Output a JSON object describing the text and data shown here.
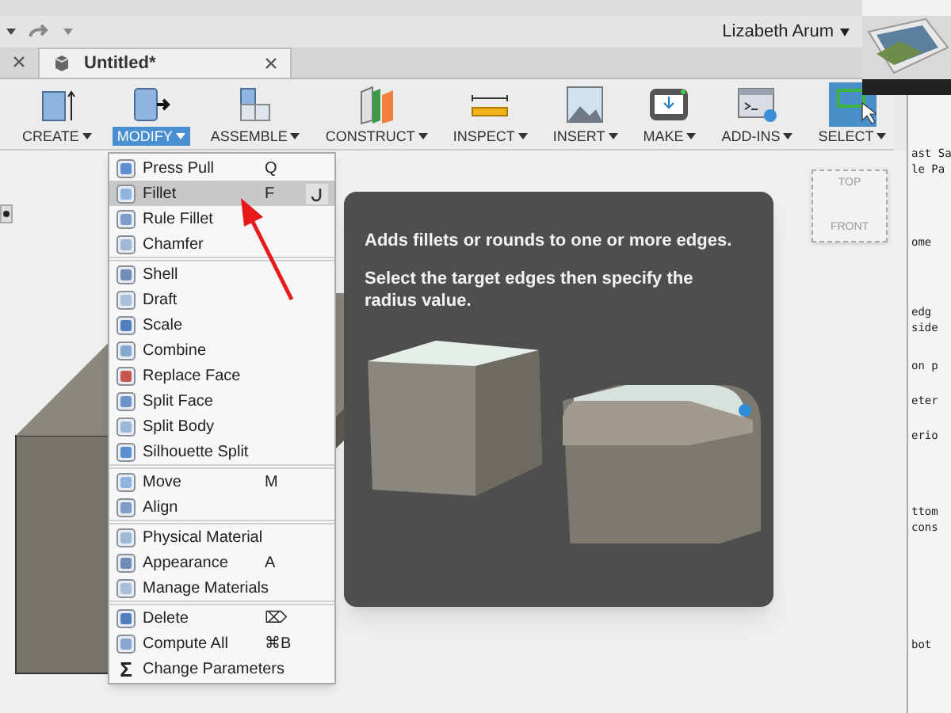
{
  "toolbar": {
    "user": "Lizabeth Arum"
  },
  "tabs": [
    {
      "label": "Untitled*",
      "selected": true
    }
  ],
  "ribbon": [
    {
      "label": "CREATE",
      "selected": false
    },
    {
      "label": "MODIFY",
      "selected": true
    },
    {
      "label": "ASSEMBLE",
      "selected": false
    },
    {
      "label": "CONSTRUCT",
      "selected": false
    },
    {
      "label": "INSPECT",
      "selected": false
    },
    {
      "label": "INSERT",
      "selected": false
    },
    {
      "label": "MAKE",
      "selected": false
    },
    {
      "label": "ADD-INS",
      "selected": false
    },
    {
      "label": "SELECT",
      "selected": false
    }
  ],
  "menu": {
    "sections": [
      [
        {
          "label": "Press Pull",
          "shortcut": "Q",
          "selected": false
        },
        {
          "label": "Fillet",
          "shortcut": "F",
          "selected": true
        },
        {
          "label": "Rule Fillet",
          "selected": false
        },
        {
          "label": "Chamfer",
          "selected": false
        }
      ],
      [
        {
          "label": "Shell",
          "selected": false
        },
        {
          "label": "Draft",
          "selected": false
        },
        {
          "label": "Scale",
          "selected": false
        },
        {
          "label": "Combine",
          "selected": false
        },
        {
          "label": "Replace Face",
          "selected": false
        },
        {
          "label": "Split Face",
          "selected": false
        },
        {
          "label": "Split Body",
          "selected": false
        },
        {
          "label": "Silhouette Split",
          "selected": false
        }
      ],
      [
        {
          "label": "Move",
          "shortcut": "M",
          "selected": false
        },
        {
          "label": "Align",
          "selected": false
        }
      ],
      [
        {
          "label": "Physical Material",
          "selected": false
        },
        {
          "label": "Appearance",
          "shortcut": "A",
          "selected": false
        },
        {
          "label": "Manage Materials",
          "selected": false
        }
      ],
      [
        {
          "label": "Delete",
          "shortcut": "⌦",
          "selected": false
        },
        {
          "label": "Compute All",
          "shortcut": "⌘B",
          "selected": false
        },
        {
          "label": "Change Parameters",
          "symbol": "Σ",
          "selected": false
        }
      ]
    ]
  },
  "tooltip": {
    "lines": [
      "Adds fillets or rounds to one or more edges.",
      "Select the target edges then specify the radius value."
    ]
  },
  "viewcube": {
    "top": "TOP",
    "front": "FRONT"
  },
  "behind_window": {
    "lines": [
      "ast Sa",
      "le Pa",
      "ome",
      "edg",
      "side",
      "on p",
      "eter",
      "erio",
      "ttom",
      "cons",
      "bot"
    ]
  }
}
